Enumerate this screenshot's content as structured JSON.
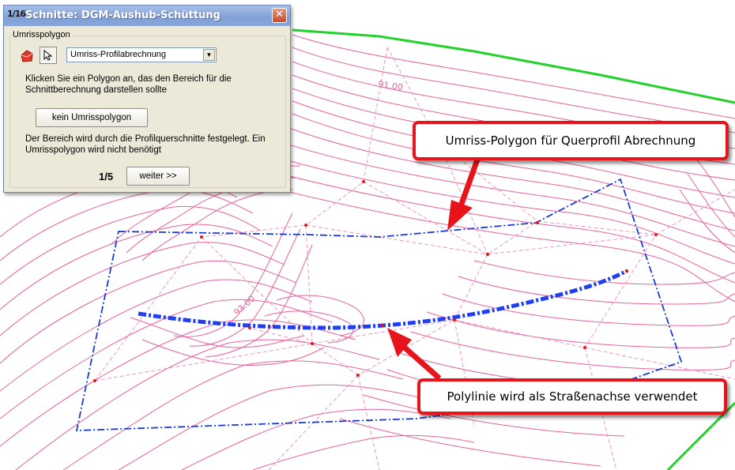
{
  "dialog": {
    "title": "Schnitte: DGM-Aushub-Schüttung",
    "app_icon_text": "1/16",
    "close_label": "✕",
    "group_label": "Umrisspolygon",
    "polygon_icon": "polygon-icon",
    "cursor_icon": "cursor-icon",
    "method_select": {
      "value": "Umriss-Profilabrechnung"
    },
    "instruction": "Klicken Sie ein Polygon an, das den Bereich für die Schnittberechnung darstellen sollte",
    "no_polygon_button": "kein Umrisspolygon",
    "info": "Der Bereich wird durch die Profilquerschnitte festgelegt. Ein Umrisspolygon wird nicht benötigt",
    "step": "1/5",
    "next_button": "weiter >>"
  },
  "drawing": {
    "contour_label_1": "91.00",
    "contour_label_2": "93.00",
    "colors": {
      "contour": "#e8619c",
      "tin": "#ea8fbe",
      "boundary": "#1a3ad8",
      "axis": "#1f3ff0",
      "border": "#22d22a",
      "vertex": "#e8141b"
    }
  },
  "callouts": {
    "top": "Umriss-Polygon für Querprofil Abrechnung",
    "bottom": "Polylinie wird als Straßenachse verwendet",
    "border_color": "#e8141b"
  }
}
